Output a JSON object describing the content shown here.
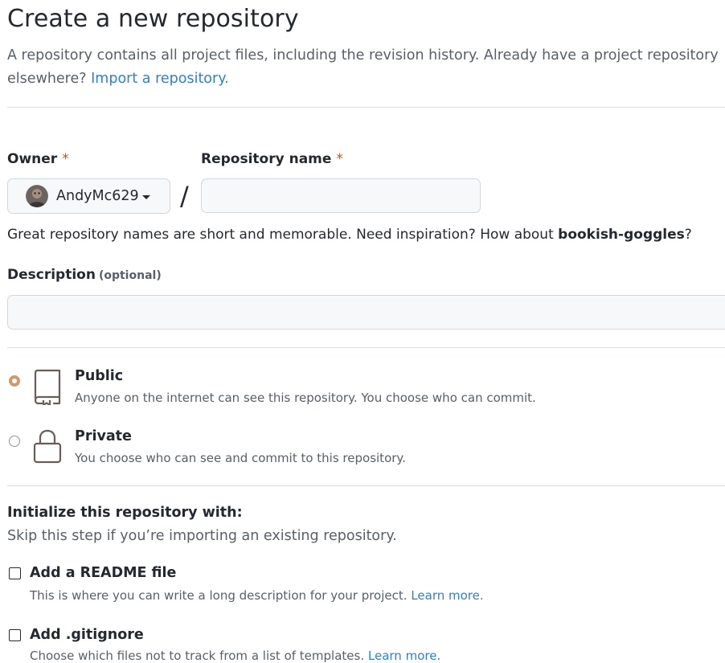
{
  "header": {
    "title": "Create a new repository",
    "subtitle": "A repository contains all project files, including the revision history. Already have a project repository elsewhere?",
    "import_link": "Import a repository."
  },
  "owner": {
    "label": "Owner",
    "required_mark": "*",
    "value": "AndyMc629"
  },
  "repo_name": {
    "label": "Repository name",
    "required_mark": "*",
    "value": "",
    "separator": "/"
  },
  "name_hint": {
    "prefix": "Great repository names are short and memorable. Need inspiration? How about ",
    "suggestion": "bookish-goggles",
    "suffix": "?"
  },
  "description": {
    "label": "Description",
    "optional": "(optional)",
    "value": ""
  },
  "visibility": {
    "selected": "public",
    "public": {
      "title": "Public",
      "desc": "Anyone on the internet can see this repository. You choose who can commit.",
      "icon": "repo-book-icon"
    },
    "private": {
      "title": "Private",
      "desc": "You choose who can see and commit to this repository.",
      "icon": "lock-icon"
    }
  },
  "initialize": {
    "title": "Initialize this repository with:",
    "subtitle": "Skip this step if you’re importing an existing repository.",
    "readme": {
      "label": "Add a README file",
      "desc": "This is where you can write a long description for your project.",
      "link": "Learn more.",
      "checked": false
    },
    "gitignore": {
      "label": "Add .gitignore",
      "desc": "Choose which files not to track from a list of templates.",
      "link": "Learn more.",
      "checked": false
    }
  },
  "colors": {
    "link": "#2f7fd0",
    "required": "#c2571a",
    "radio_selected": "#d09a6e",
    "icon_stroke": "#6b5c55"
  }
}
